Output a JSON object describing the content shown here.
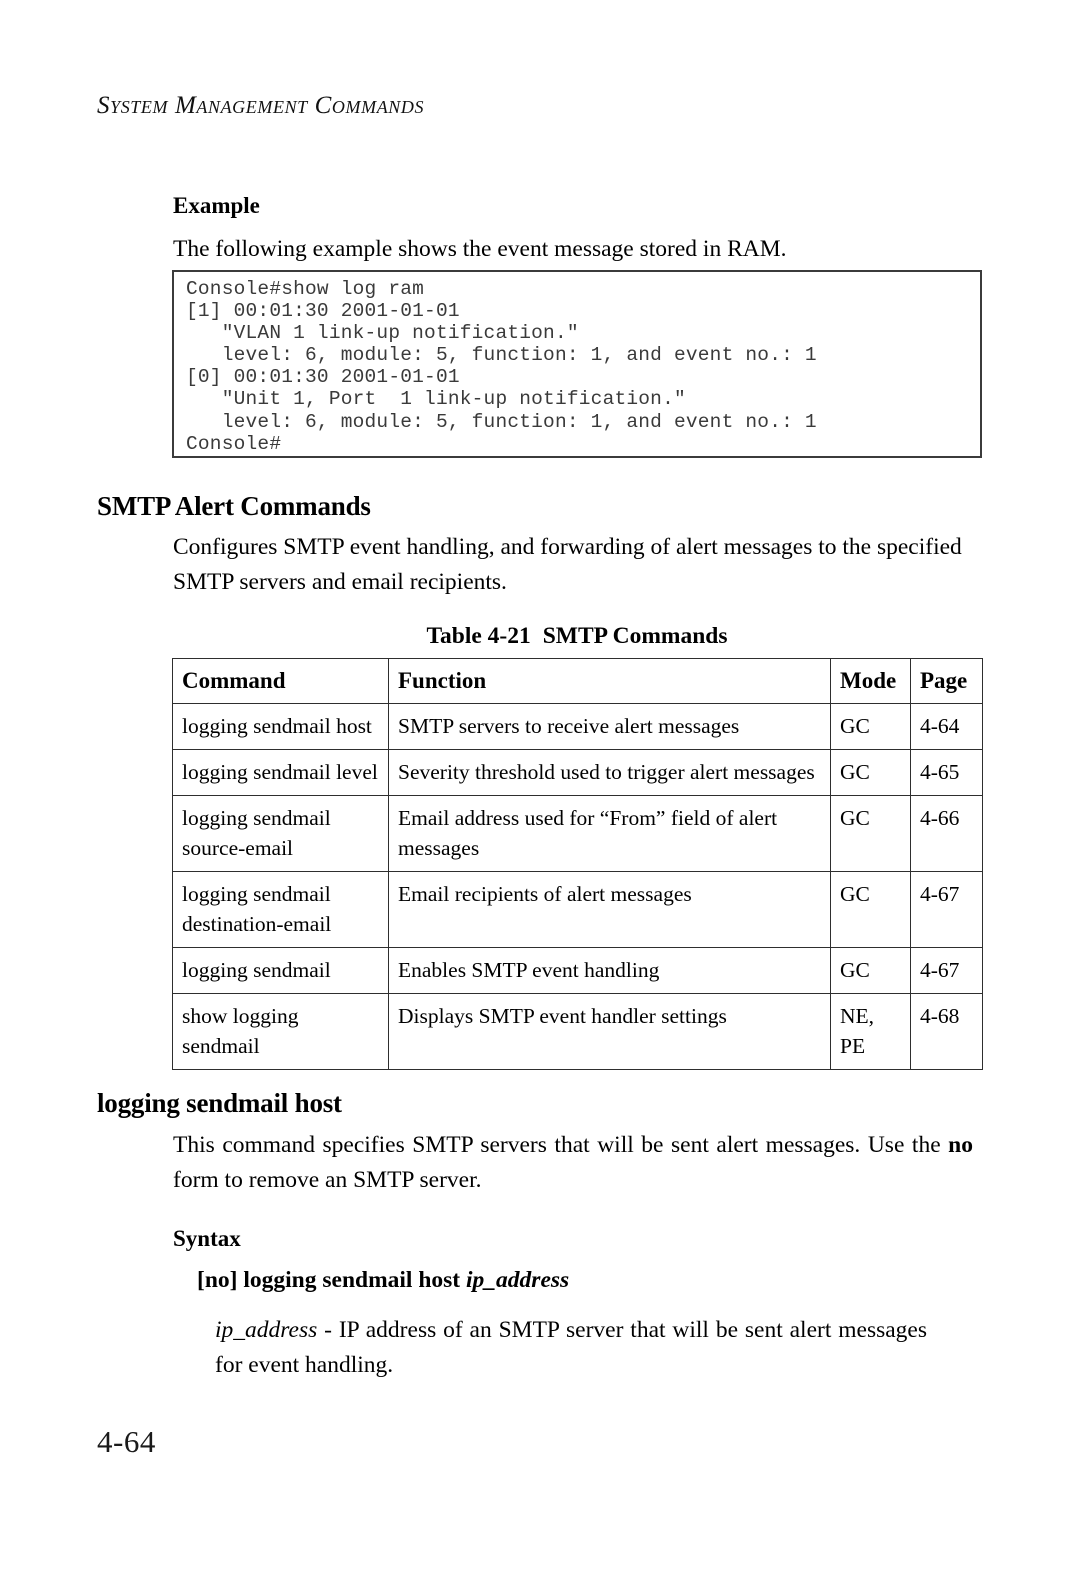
{
  "header": {
    "running_title": "System Management Commands"
  },
  "example_section": {
    "heading": "Example",
    "intro": "The following example shows the event message stored in RAM.",
    "console_output": "Console#show log ram\n[1] 00:01:30 2001-01-01\n   \"VLAN 1 link-up notification.\"\n   level: 6, module: 5, function: 1, and event no.: 1\n[0] 00:01:30 2001-01-01\n   \"Unit 1, Port  1 link-up notification.\"\n   level: 6, module: 5, function: 1, and event no.: 1\nConsole#"
  },
  "smtp_section": {
    "heading": "SMTP Alert Commands",
    "description": "Configures SMTP event handling, and forwarding of alert messages to the specified SMTP servers and email recipients."
  },
  "table": {
    "caption_label": "Table 4-21",
    "caption_title": "SMTP Commands",
    "headers": [
      "Command",
      "Function",
      "Mode",
      "Page"
    ],
    "rows": [
      {
        "command": "logging sendmail host",
        "function": "SMTP servers to receive alert messages",
        "mode": "GC",
        "page": "4-64"
      },
      {
        "command": "logging sendmail level",
        "function": "Severity threshold used to trigger alert messages",
        "mode": "GC",
        "page": "4-65"
      },
      {
        "command": "logging sendmail source-email",
        "function": "Email address used for “From” field of alert messages",
        "mode": "GC",
        "page": "4-66"
      },
      {
        "command": "logging sendmail destination-email",
        "function": "Email recipients of alert messages",
        "mode": "GC",
        "page": "4-67"
      },
      {
        "command": "logging sendmail",
        "function": "Enables SMTP event handling",
        "mode": "GC",
        "page": "4-67"
      },
      {
        "command": "show logging sendmail",
        "function": "Displays SMTP event handler settings",
        "mode": "NE, PE",
        "page": "4-68"
      }
    ]
  },
  "command_section": {
    "heading": "logging sendmail host",
    "description_part1": "This command specifies SMTP servers that will be sent alert messages. Use the ",
    "description_bold": "no",
    "description_part2": " form to remove an SMTP server.",
    "syntax_heading": "Syntax",
    "syntax_optional": "[no]",
    "syntax_command": "logging sendmail host",
    "syntax_variable": "ip_address",
    "param_name": "ip_address",
    "param_description": " - IP address of an SMTP server that will be sent alert messages for event handling."
  },
  "folio": {
    "page_number": "4-64"
  }
}
